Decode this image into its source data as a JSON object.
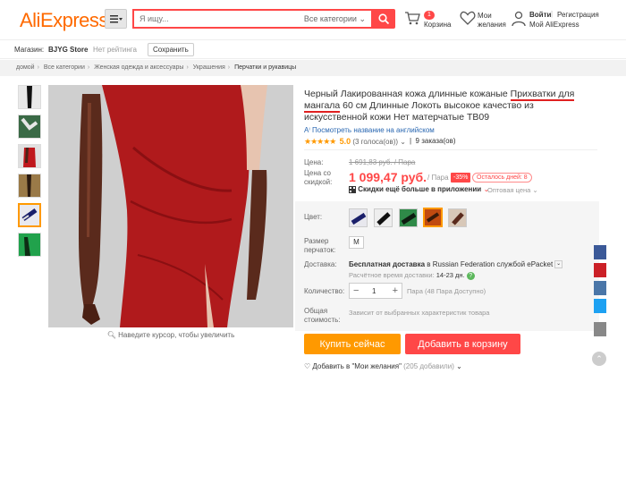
{
  "header": {
    "logo": "AliExpress",
    "search_placeholder": "Я ищу...",
    "category_select": "Все категории",
    "cart_count": "1",
    "cart_label": "Корзина",
    "wishlist_label": "Мои желания",
    "login": "Войти",
    "register": "Регистрация",
    "my_account": "Мой AliExpress"
  },
  "store": {
    "label": "Магазин:",
    "name": "BJYG Store",
    "rating": "Нет рейтинга",
    "save": "Сохранить"
  },
  "breadcrumb": [
    "домой",
    "Все категории",
    "Женская одежда и аксессуары",
    "Украшения",
    "Перчатки и рукавицы"
  ],
  "product": {
    "title_before": "Черный Лакированная кожа длинные кожаные ",
    "title_underlined": "Прихватки для мангала",
    "title_after": " 60 см Длинные Локоть высокое качество из искусственной кожи Нет матерчатые TB09",
    "translate_link": "Посмотреть название на английском",
    "stars": "★★★★★",
    "rating": "5.0",
    "votes": "(3 голоса(ов))",
    "orders": "9 заказа(ов)",
    "price_label": "Цена:",
    "old_price": "1 691,83 руб. / Пара",
    "discount_price_label": "Цена со скидкой:",
    "new_price": "1 099,47 руб.",
    "unit": "/ Пара",
    "discount": "-35%",
    "days_left": "Осталось дней: 8",
    "app_discount": "Скидки ещё больше в приложении",
    "wholesale": "Оптовая цена",
    "color_label": "Цвет:",
    "size_label": "Размер перчаток:",
    "size": "M",
    "shipping_label": "Доставка:",
    "shipping_free": "Бесплатная доставка",
    "shipping_to": " в Russian Federation службой ePacket",
    "delivery_time_label": "Расчётное время доставки: ",
    "delivery_time": "14-23 дн.",
    "quantity_label": "Количество:",
    "quantity": "1",
    "quantity_note": "Пара (48 Пара Доступно)",
    "total_label": "Общая стоимость:",
    "total_note": "Зависит от выбранных характеристик товара",
    "buy_now": "Купить сейчас",
    "add_to_cart": "Добавить в корзину",
    "wishlist_add": "Добавить в \"Мои желания\"",
    "wishlist_count": "(205 добавили)",
    "zoom_hint": "Наведите курсор, чтобы увеличить"
  },
  "colors": {
    "brand": "#ff6a00",
    "accent_red": "#ff4747",
    "buy_orange": "#ff9900"
  }
}
